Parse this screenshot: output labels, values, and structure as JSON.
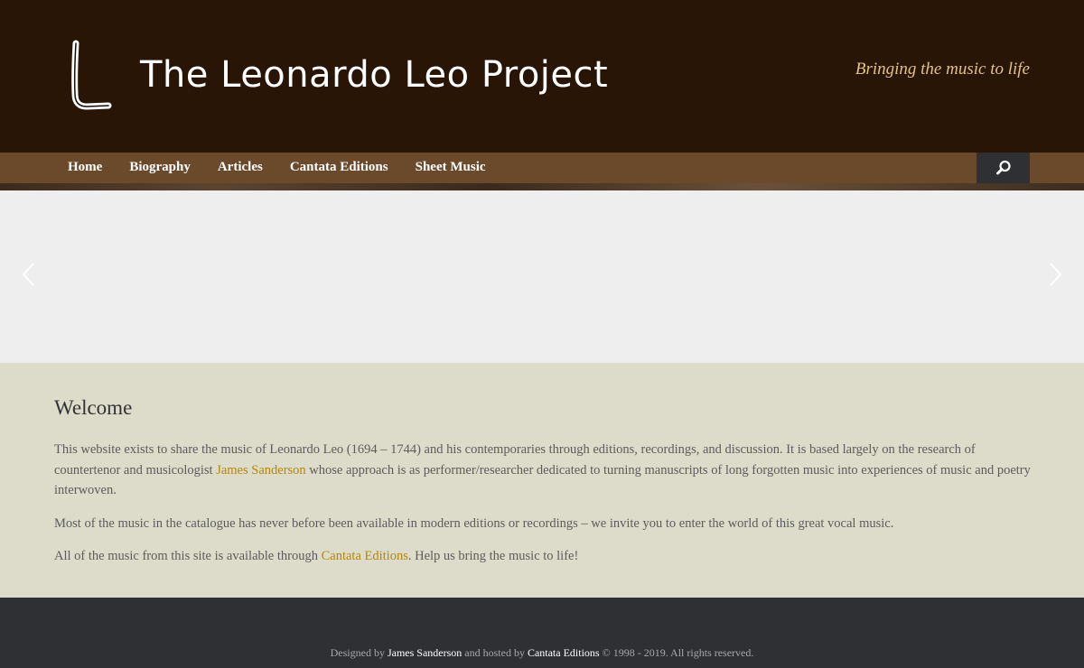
{
  "header": {
    "logo_letter": "L",
    "title": "The Leonardo Leo Project",
    "tagline": "Bringing the music to life"
  },
  "nav": {
    "items": [
      {
        "label": "Home"
      },
      {
        "label": "Biography"
      },
      {
        "label": "Articles"
      },
      {
        "label": "Cantata Editions"
      },
      {
        "label": "Sheet Music"
      }
    ],
    "search_icon": "search-icon"
  },
  "slider": {
    "prev_icon": "chevron-left-icon",
    "next_icon": "chevron-right-icon"
  },
  "content": {
    "heading": "Welcome",
    "p1_a": "This website exists to share the music of Leonardo Leo (1694 – 1744) and his contemporaries through editions, recordings, and discussion. It is based largely on the research of countertenor and musicologist ",
    "p1_link": "James Sanderson",
    "p1_b": " whose approach is as performer/researcher dedicated to turning manuscripts of long forgotten music into experiences of music and poetry interwoven.",
    "p2": "Most of the music in the catalogue has never before been available in modern editions or recordings – we invite you to enter the world of this great vocal music.",
    "p3_a": "All of the music from this site is available through ",
    "p3_link": "Cantata Editions",
    "p3_b": ". Help us bring the music to life!"
  },
  "footer": {
    "designed_by": "Designed by ",
    "designer": "James Sanderson",
    "hosted_by": " and hosted by ",
    "host": "Cantata Editions",
    "rights": " © 1998 - 2019. All rights reserved."
  },
  "colors": {
    "header_bg": "#281505",
    "nav_bg": "#6b4a2b",
    "accent": "#b8860b",
    "tagline": "#e2c386",
    "content_bg": "#dddbc9",
    "footer_bg": "#2f3034"
  }
}
